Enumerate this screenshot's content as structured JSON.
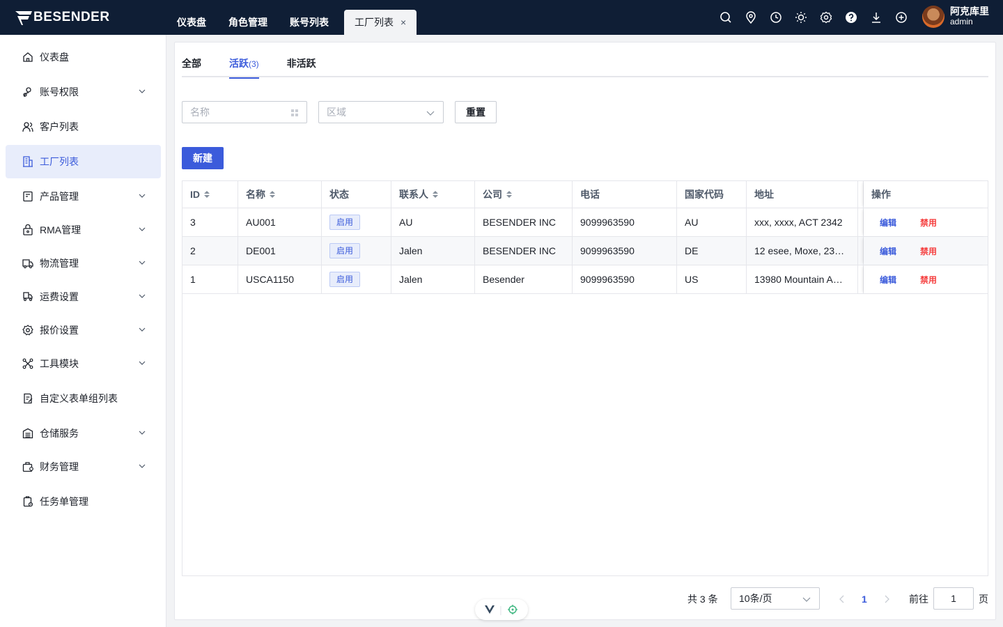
{
  "app": {
    "brand": "BESENDER"
  },
  "top_tabs": [
    {
      "label": "仪表盘"
    },
    {
      "label": "角色管理"
    },
    {
      "label": "账号列表"
    },
    {
      "label": "工厂列表",
      "active": true,
      "close": "×"
    }
  ],
  "top_icons": [
    "search-icon",
    "location-icon",
    "clock-icon",
    "sun-icon",
    "gear-icon",
    "help-icon",
    "download-icon",
    "plus-circle-icon"
  ],
  "user": {
    "name": "阿克库里",
    "role": "admin"
  },
  "sidebar": {
    "items": [
      {
        "label": "仪表盘",
        "icon": "home-icon",
        "expandable": false
      },
      {
        "label": "账号权限",
        "icon": "user-key-icon",
        "expandable": true
      },
      {
        "label": "客户列表",
        "icon": "users-icon",
        "expandable": false
      },
      {
        "label": "工厂列表",
        "icon": "building-icon",
        "expandable": false,
        "active": true
      },
      {
        "label": "产品管理",
        "icon": "product-icon",
        "expandable": true
      },
      {
        "label": "RMA管理",
        "icon": "rma-icon",
        "expandable": true
      },
      {
        "label": "物流管理",
        "icon": "truck-icon",
        "expandable": true
      },
      {
        "label": "运费设置",
        "icon": "freight-icon",
        "expandable": true
      },
      {
        "label": "报价设置",
        "icon": "quote-gear-icon",
        "expandable": true
      },
      {
        "label": "工具模块",
        "icon": "tools-icon",
        "expandable": true
      },
      {
        "label": "自定义表单组列表",
        "icon": "form-icon",
        "expandable": false
      },
      {
        "label": "仓储服务",
        "icon": "warehouse-icon",
        "expandable": true
      },
      {
        "label": "财务管理",
        "icon": "finance-icon",
        "expandable": true
      },
      {
        "label": "任务单管理",
        "icon": "task-icon",
        "expandable": false
      }
    ]
  },
  "subtabs": [
    {
      "label": "全部",
      "count": ""
    },
    {
      "label": "活跃",
      "count": "(3)",
      "active": true
    },
    {
      "label": "非活跃",
      "count": ""
    }
  ],
  "filters": {
    "name_placeholder": "名称",
    "region_placeholder": "区域",
    "reset_label": "重置"
  },
  "new_button": "新建",
  "table": {
    "columns": [
      "ID",
      "名称",
      "状态",
      "联系人",
      "公司",
      "电话",
      "国家代码",
      "地址",
      "操作"
    ],
    "rows": [
      {
        "id": "3",
        "name": "AU001",
        "status": "启用",
        "contact": "AU",
        "company": "BESENDER INC",
        "phone": "9099963590",
        "country": "AU",
        "address": "xxx, xxxx, ACT 2342",
        "edit": "编辑",
        "disable": "禁用"
      },
      {
        "id": "2",
        "name": "DE001",
        "status": "启用",
        "contact": "Jalen",
        "company": "BESENDER INC",
        "phone": "9099963590",
        "country": "DE",
        "address": "12 esee, Moxe, 23…",
        "edit": "编辑",
        "disable": "禁用"
      },
      {
        "id": "1",
        "name": "USCA1150",
        "status": "启用",
        "contact": "Jalen",
        "company": "Besender",
        "phone": "9099963590",
        "country": "US",
        "address": "13980 Mountain A…",
        "edit": "编辑",
        "disable": "禁用"
      }
    ]
  },
  "pagination": {
    "total": "共 3 条",
    "page_size": "10条/页",
    "current_page": "1",
    "goto_label": "前往",
    "goto_value": "1",
    "page_suffix": "页"
  },
  "colors": {
    "topbar": "#0f1e35",
    "accent": "#3b5bdb",
    "danger": "#f53f3f"
  }
}
